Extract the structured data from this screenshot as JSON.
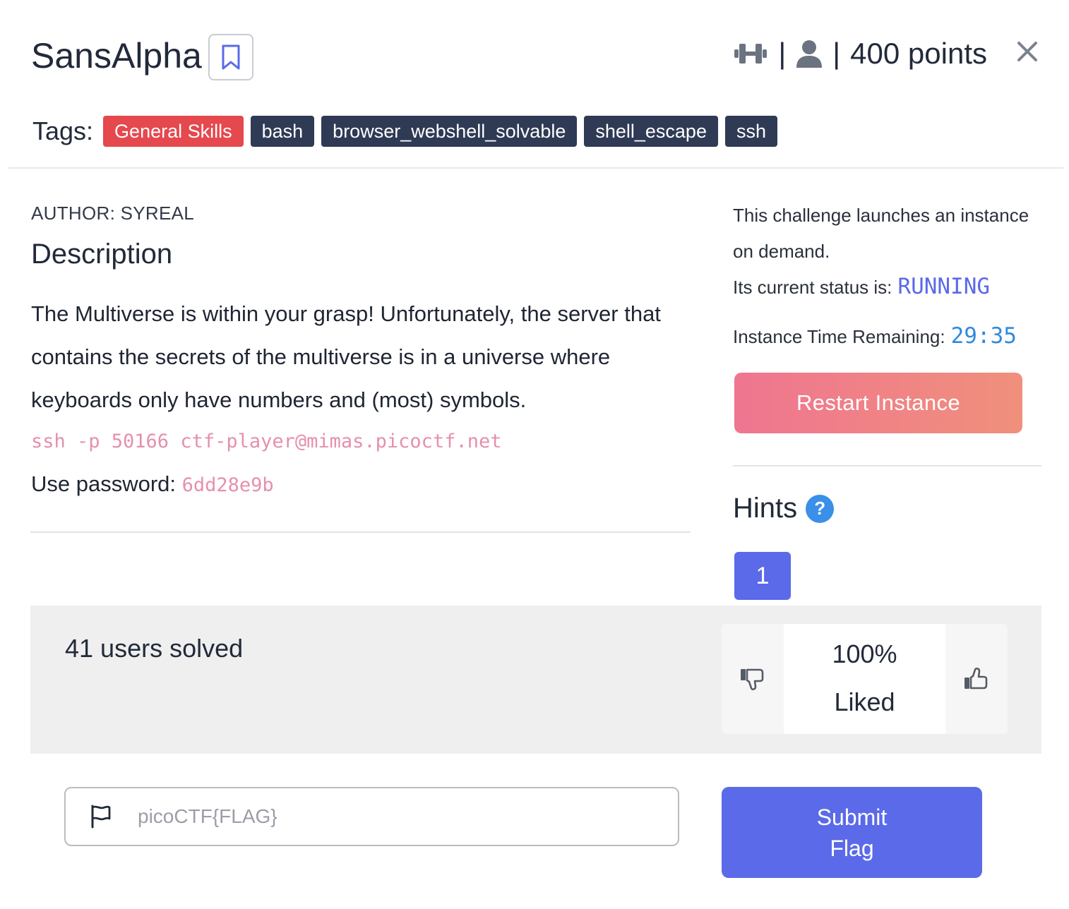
{
  "challenge": {
    "title": "SansAlpha",
    "points": "400 points",
    "meta_sep": "|"
  },
  "tags": {
    "label": "Tags:",
    "items": [
      "General Skills",
      "bash",
      "browser_webshell_solvable",
      "shell_escape",
      "ssh"
    ]
  },
  "description": {
    "author": "AUTHOR: SYREAL",
    "heading": "Description",
    "text": "The Multiverse is within your grasp! Unfortunately, the server that contains the secrets of the multiverse is in a universe where keyboards only have numbers and (most) symbols.",
    "ssh_command": "ssh -p 50166 ctf-player@mimas.picoctf.net",
    "password_label": "Use password: ",
    "password": "6dd28e9b"
  },
  "instance": {
    "info": "This challenge launches an instance on demand.",
    "status_label": "Its current status is:",
    "status": "RUNNING",
    "time_label": "Instance Time Remaining:",
    "time_remaining": "29:35",
    "restart_label": "Restart Instance"
  },
  "hints": {
    "heading": "Hints",
    "help_glyph": "?",
    "items": [
      "1"
    ]
  },
  "stats": {
    "solved": "41 users solved",
    "liked_pct": "100%",
    "liked_word": "Liked"
  },
  "flag": {
    "placeholder": "picoCTF{FLAG}",
    "submit_label": "Submit Flag"
  },
  "colors": {
    "accent": "#5b6ae8",
    "primary_tag": "#e5484d",
    "dark_tag": "#2f3a55",
    "code_pink": "#e590ad",
    "restart_gradient_start": "#ef7590",
    "restart_gradient_end": "#f0907c"
  },
  "icons": {
    "bookmark": "bookmark-icon",
    "difficulty": "dumbbell-icon",
    "author": "user-icon",
    "close": "close-icon",
    "dislike": "thumbs-down-icon",
    "like": "thumbs-up-icon",
    "flag": "flag-icon",
    "help": "question-circle-icon"
  }
}
